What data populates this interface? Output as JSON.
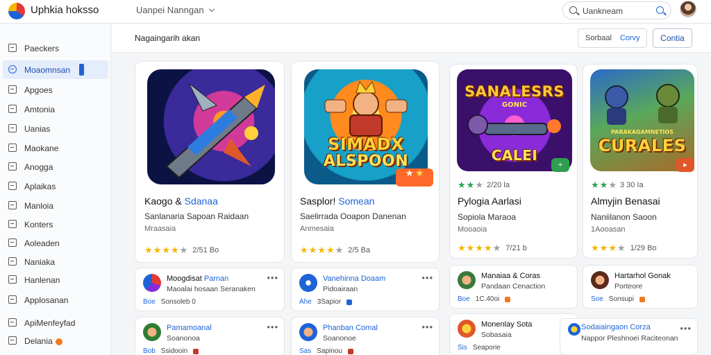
{
  "app": {
    "title": "Uphkia hoksso",
    "workspace": "Uanpei Nanngan"
  },
  "search": {
    "value": "Uankneam"
  },
  "sidebar": {
    "items": [
      {
        "label": "Paeckers"
      },
      {
        "label": "Moaomnsan"
      },
      {
        "label": "Apgoes"
      },
      {
        "label": "Amtonia"
      },
      {
        "label": "Uanias"
      },
      {
        "label": "Maokane"
      },
      {
        "label": "Anogga"
      },
      {
        "label": "Aplaikas"
      },
      {
        "label": "Manloia"
      },
      {
        "label": "Konters"
      },
      {
        "label": "Aoleaden"
      },
      {
        "label": "Naniaka"
      },
      {
        "label": "Hanlenan"
      },
      {
        "label": "Applosanan"
      },
      {
        "label": "ApiMenfeyfad"
      },
      {
        "label": "Delania"
      }
    ]
  },
  "header": {
    "title": "Nagaingarih akan",
    "seg_a": "Sorbaal",
    "seg_b": "Corvy",
    "action": "Contia"
  },
  "games": [
    {
      "title_a": "Kaogo & ",
      "title_b": "Sdanaa",
      "subtitle": "Sanlanaria Sapoan Raidaan",
      "meta": "Mraasaia",
      "rating_text": "2/51 Bo",
      "stars": [
        1,
        1,
        1,
        1,
        0
      ]
    },
    {
      "title_a": "Sasplor! ",
      "title_b": "Somean",
      "subtitle": "Saelirrada Ooapon Danenan",
      "meta": "Anmesaia",
      "rating_text": "2/5 Ba",
      "stars": [
        1,
        1,
        1,
        1,
        0
      ],
      "art_line1": "SIMADX",
      "art_line2": "ALSPOON"
    },
    {
      "title_a": "Pylogia Aarlasi",
      "title_b": "",
      "subtitle": "Sopiola Maraoa",
      "meta": "Mooaoia",
      "rating_text": "7/21 b",
      "stars": [
        1,
        1,
        1,
        1,
        0
      ],
      "top_rating": "2/20 la",
      "art_line1": "SANALESRS",
      "art_line2": "GONIC",
      "art_line3": "CALEI"
    },
    {
      "title_a": "Almyjin Benasai",
      "title_b": "",
      "subtitle": "Naniilanon Saoon",
      "meta": "1Aooasan",
      "rating_text": "1/29 Bo",
      "stars": [
        1,
        1,
        1,
        0,
        0
      ],
      "top_rating": "3 30 Ia",
      "art_line1": "PARAKAGAMNETIOS",
      "art_line2": "CURALES"
    }
  ],
  "small_cards": [
    {
      "title_a": "Moogdisat ",
      "title_b": "Parnan",
      "subtitle": "Maoalai hosaan Seranaken",
      "foot_a": "Boe",
      "foot_b": "Sonsoleb 0"
    },
    {
      "title_a": "",
      "title_b": "Vanehinna Doaam",
      "subtitle": "Pidoairaan",
      "foot_a": "Ahe",
      "foot_b": "3Sapior"
    },
    {
      "title_a": "Manaiaa & Coras",
      "title_b": "",
      "subtitle": "Pandaan Cenaction",
      "foot_a": "Boe",
      "foot_b": "1C.40oi"
    },
    {
      "title_a": "Hartarhol Gonak",
      "title_b": "",
      "subtitle": "Porteore",
      "foot_a": "Soe",
      "foot_b": "Sonsupi"
    },
    {
      "title_a": "",
      "title_b": "Pamamoanal",
      "subtitle": "Soanonoa",
      "foot_a": "Bob",
      "foot_b": "Ssidooin"
    },
    {
      "title_a": "",
      "title_b": "Phanban Comal",
      "subtitle": "Soanonoe",
      "foot_a": "Sas",
      "foot_b": "Sapinou"
    },
    {
      "title_a": "Monenlay Sota",
      "title_b": "",
      "subtitle": "Sobasaia",
      "foot_a": "Sis",
      "foot_b": "Seaporie"
    },
    {
      "title_a": "",
      "title_b": "Sodaiaingaon Corza",
      "subtitle": "Nappor Pleshnoei Raciteonan",
      "foot_a": "",
      "foot_b": ""
    }
  ]
}
